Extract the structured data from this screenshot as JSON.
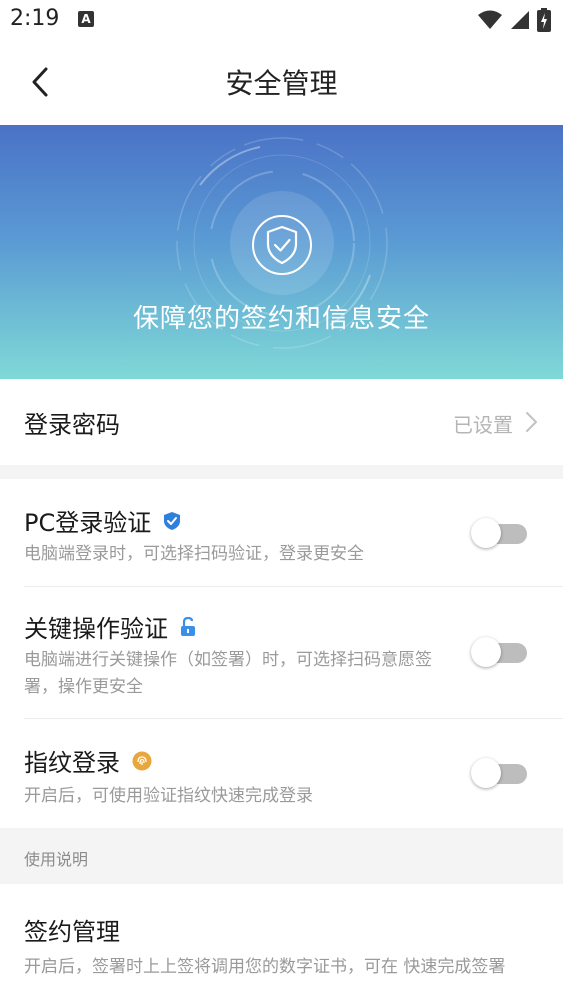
{
  "status_bar": {
    "time": "2:19",
    "notification_icon_letter": "A",
    "icons": [
      "wifi-icon",
      "signal-icon",
      "battery-icon"
    ]
  },
  "nav": {
    "title": "安全管理",
    "back_icon": "chevron-left-icon"
  },
  "banner": {
    "icon": "shield-check-icon",
    "text": "保障您的签约和信息安全",
    "gradient_top": "#4a72c6",
    "gradient_bottom": "#7fd9d6"
  },
  "password_row": {
    "title": "登录密码",
    "value": "已设置",
    "arrow_icon": "chevron-right-icon"
  },
  "settings": [
    {
      "title": "PC登录验证",
      "icon": "shield-badge-icon",
      "icon_color": "#2f7fdc",
      "desc": "电脑端登录时，可选择扫码验证，登录更安全",
      "enabled": false
    },
    {
      "title": "关键操作验证",
      "icon": "unlock-icon",
      "icon_color": "#3a8fe8",
      "desc": "电脑端进行关键操作（如签署）时，可选择扫码意愿签署，操作更安全",
      "enabled": false
    },
    {
      "title": "指纹登录",
      "icon": "fingerprint-icon",
      "icon_color": "#e8a63c",
      "desc": "开启后，可使用验证指纹快速完成登录",
      "enabled": false
    }
  ],
  "section_header": "使用说明",
  "sign_management": {
    "title": "签约管理",
    "desc": "开启后，签署时上上签将调用您的数字证书，可在                快速完成签署"
  },
  "colors": {
    "toggle_off_track": "#bdbdbd",
    "secondary_text": "#9a9a9a",
    "page_gap": "#f4f4f4"
  }
}
